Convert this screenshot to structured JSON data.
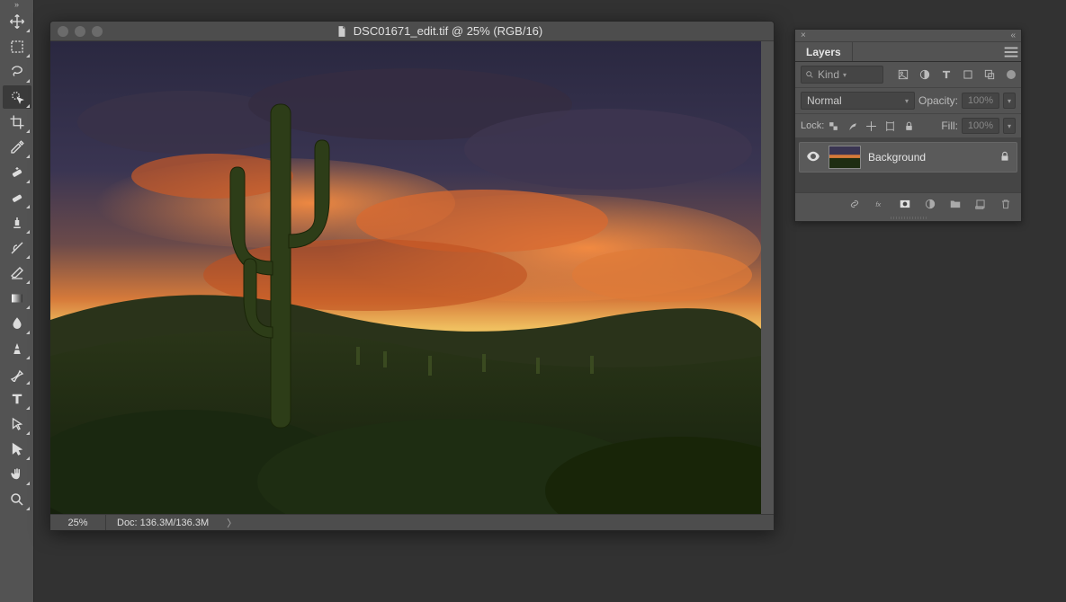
{
  "toolbar": {
    "tools": [
      {
        "name": "move-tool"
      },
      {
        "name": "marquee-tool"
      },
      {
        "name": "lasso-tool"
      },
      {
        "name": "quick-select-tool",
        "selected": true
      },
      {
        "name": "crop-tool"
      },
      {
        "name": "eyedropper-tool"
      },
      {
        "name": "healing-brush-tool"
      },
      {
        "name": "brush-tool"
      },
      {
        "name": "clone-stamp-tool"
      },
      {
        "name": "history-brush-tool"
      },
      {
        "name": "eraser-tool"
      },
      {
        "name": "gradient-tool"
      },
      {
        "name": "blur-tool"
      },
      {
        "name": "dodge-tool"
      },
      {
        "name": "pen-tool"
      },
      {
        "name": "type-tool"
      },
      {
        "name": "path-select-tool"
      },
      {
        "name": "shape-tool"
      },
      {
        "name": "hand-tool"
      },
      {
        "name": "zoom-tool"
      }
    ]
  },
  "document": {
    "title": "DSC01671_edit.tif @ 25% (RGB/16)",
    "zoom": "25%",
    "doc_info": "Doc: 136.3M/136.3M"
  },
  "layers_panel": {
    "tab": "Layers",
    "filter_label": "Kind",
    "blend_mode": "Normal",
    "opacity_label": "Opacity:",
    "opacity_value": "100%",
    "lock_label": "Lock:",
    "fill_label": "Fill:",
    "fill_value": "100%",
    "layers": [
      {
        "name": "Background",
        "locked": true
      }
    ]
  }
}
